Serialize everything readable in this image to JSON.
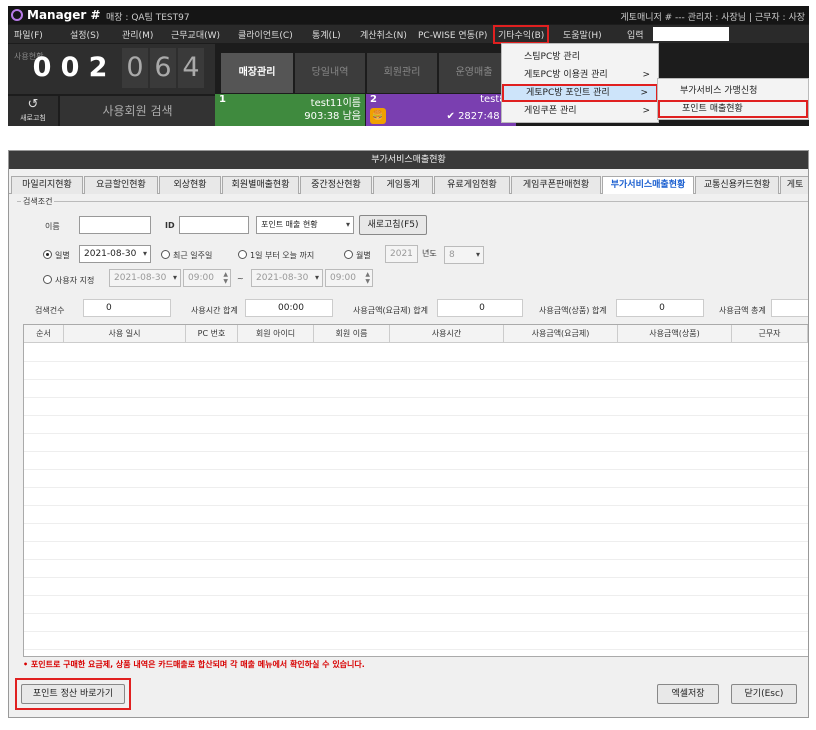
{
  "manager": {
    "app_name": "Manager #",
    "store_info": "매장 : QA팀 TEST97",
    "right_info": "게토매니저 # --- 관리자 : 사장님 | 근무자 : 사장",
    "menu": [
      "파일(F)",
      "설정(S)",
      "관리(M)",
      "근무교대(W)",
      "클라이언트(C)",
      "통계(L)",
      "계산취소(N)",
      "PC-WISE 연동(P)",
      "기타수익(B)",
      "도움말(H)",
      "입력"
    ],
    "counter_label": "사용현황",
    "digits": [
      "0",
      "0",
      "2",
      "0",
      "6",
      "4"
    ],
    "refresh_label": "새로고침",
    "member_search": "사용회원 검색",
    "tabs": [
      "매장관리",
      "당일내역",
      "회원관리",
      "운영매출"
    ],
    "pc1": {
      "num": "1",
      "name": "test11이름",
      "time": "903:38 남음"
    },
    "pc2": {
      "num": "2",
      "name": "test80",
      "time": "✔ 2827:48 사"
    },
    "dropdown": [
      {
        "label": "스팀PC방 관리",
        "arrow": ""
      },
      {
        "label": "게토PC방 이용권 관리",
        "arrow": ">"
      },
      {
        "label": "게토PC방 포인트 관리",
        "arrow": ">"
      },
      {
        "label": "게임쿠폰 관리",
        "arrow": ">"
      }
    ],
    "submenu": [
      "부가서비스 가맹신청",
      "포인트 매출현황"
    ]
  },
  "window": {
    "title": "부가서비스매출현황",
    "tabs": [
      "마일리지현황",
      "요금할인현황",
      "외상현황",
      "회원별매출현황",
      "중간정산현황",
      "게임통계",
      "유료게임현황",
      "게임쿠폰판매현황",
      "부가서비스매출현황",
      "교통신용카드현황",
      "게토"
    ],
    "active_tab": "부가서비스매출현황",
    "search_group": "검색조건",
    "name_label": "이름",
    "name_value": "",
    "id_label": "ID",
    "id_value": "",
    "type_select": "포인트 매출 현황",
    "refresh_button": "새로고침(F5)",
    "radio_daily": "일별",
    "daily_date": "2021-08-30",
    "radio_recent_week": "최근 일주일",
    "radio_month_start": "1일 부터 오늘 까지",
    "radio_monthly": "월별",
    "year_value": "2021",
    "year_label": "년도",
    "month_value": "8",
    "radio_custom": "사용자 지정",
    "custom_from_date": "2021-08-30",
    "custom_from_time": "09:00",
    "tilde": "~",
    "custom_to_date": "2021-08-30",
    "custom_to_time": "09:00",
    "summary": [
      {
        "label": "검색건수",
        "value": "0"
      },
      {
        "label": "사용시간 합계",
        "value": "00:00"
      },
      {
        "label": "사용금액(요금제) 합계",
        "value": "0"
      },
      {
        "label": "사용금액(상품) 합계",
        "value": "0"
      },
      {
        "label": "사용금액 총계",
        "value": ""
      }
    ],
    "columns": [
      "순서",
      "사용 일시",
      "PC 번호",
      "회원 아이디",
      "회원 이름",
      "사용시간",
      "사용금액(요금제)",
      "사용금액(상품)",
      "근무자"
    ],
    "notice": "• 포인트로 구매한 요금제, 상품 내역은 카드매출로 합산되며 각 매출 메뉴에서 확인하실 수 있습니다.",
    "point_settle_button": "포인트 정산 바로가기",
    "excel_button": "엑셀저장",
    "close_button": "닫기(Esc)"
  },
  "colors": {
    "highlight": "#e02020",
    "active_tab_text": "#1a5fd0",
    "notice": "#d80000",
    "pc1_bg": "#3f8a3e",
    "pc2_bg": "#7a3fb0"
  }
}
